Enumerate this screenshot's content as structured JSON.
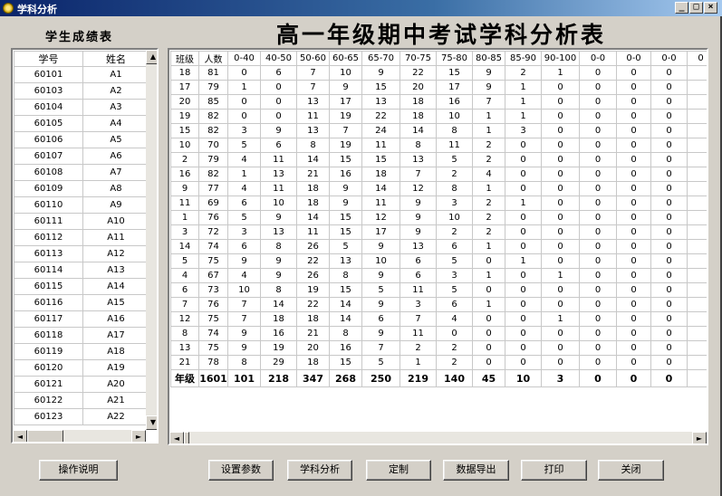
{
  "window": {
    "title": "学科分析",
    "min": "_",
    "max": "□",
    "close": "×"
  },
  "left_heading": "学生成绩表",
  "main_heading": "高一年级期中考试学科分析表",
  "students": {
    "headers": [
      "学号",
      "姓名"
    ],
    "rows": [
      [
        "60101",
        "A1"
      ],
      [
        "60103",
        "A2"
      ],
      [
        "60104",
        "A3"
      ],
      [
        "60105",
        "A4"
      ],
      [
        "60106",
        "A5"
      ],
      [
        "60107",
        "A6"
      ],
      [
        "60108",
        "A7"
      ],
      [
        "60109",
        "A8"
      ],
      [
        "60110",
        "A9"
      ],
      [
        "60111",
        "A10"
      ],
      [
        "60112",
        "A11"
      ],
      [
        "60113",
        "A12"
      ],
      [
        "60114",
        "A13"
      ],
      [
        "60115",
        "A14"
      ],
      [
        "60116",
        "A15"
      ],
      [
        "60117",
        "A16"
      ],
      [
        "60118",
        "A17"
      ],
      [
        "60119",
        "A18"
      ],
      [
        "60120",
        "A19"
      ],
      [
        "60121",
        "A20"
      ],
      [
        "60122",
        "A21"
      ],
      [
        "60123",
        "A22"
      ]
    ]
  },
  "analysis": {
    "headers": [
      "班级",
      "人数",
      "0-40",
      "40-50",
      "50-60",
      "60-65",
      "65-70",
      "70-75",
      "75-80",
      "80-85",
      "85-90",
      "90-100",
      "0-0",
      "0-0",
      "0-0",
      "0"
    ],
    "rows": [
      [
        "18",
        "81",
        "0",
        "6",
        "7",
        "10",
        "9",
        "22",
        "15",
        "9",
        "2",
        "1",
        "0",
        "0",
        "0",
        ""
      ],
      [
        "17",
        "79",
        "1",
        "0",
        "7",
        "9",
        "15",
        "20",
        "17",
        "9",
        "1",
        "0",
        "0",
        "0",
        "0",
        ""
      ],
      [
        "20",
        "85",
        "0",
        "0",
        "13",
        "17",
        "13",
        "18",
        "16",
        "7",
        "1",
        "0",
        "0",
        "0",
        "0",
        ""
      ],
      [
        "19",
        "82",
        "0",
        "0",
        "11",
        "19",
        "22",
        "18",
        "10",
        "1",
        "1",
        "0",
        "0",
        "0",
        "0",
        ""
      ],
      [
        "15",
        "82",
        "3",
        "9",
        "13",
        "7",
        "24",
        "14",
        "8",
        "1",
        "3",
        "0",
        "0",
        "0",
        "0",
        ""
      ],
      [
        "10",
        "70",
        "5",
        "6",
        "8",
        "19",
        "11",
        "8",
        "11",
        "2",
        "0",
        "0",
        "0",
        "0",
        "0",
        ""
      ],
      [
        "2",
        "79",
        "4",
        "11",
        "14",
        "15",
        "15",
        "13",
        "5",
        "2",
        "0",
        "0",
        "0",
        "0",
        "0",
        ""
      ],
      [
        "16",
        "82",
        "1",
        "13",
        "21",
        "16",
        "18",
        "7",
        "2",
        "4",
        "0",
        "0",
        "0",
        "0",
        "0",
        ""
      ],
      [
        "9",
        "77",
        "4",
        "11",
        "18",
        "9",
        "14",
        "12",
        "8",
        "1",
        "0",
        "0",
        "0",
        "0",
        "0",
        ""
      ],
      [
        "11",
        "69",
        "6",
        "10",
        "18",
        "9",
        "11",
        "9",
        "3",
        "2",
        "1",
        "0",
        "0",
        "0",
        "0",
        ""
      ],
      [
        "1",
        "76",
        "5",
        "9",
        "14",
        "15",
        "12",
        "9",
        "10",
        "2",
        "0",
        "0",
        "0",
        "0",
        "0",
        ""
      ],
      [
        "3",
        "72",
        "3",
        "13",
        "11",
        "15",
        "17",
        "9",
        "2",
        "2",
        "0",
        "0",
        "0",
        "0",
        "0",
        ""
      ],
      [
        "14",
        "74",
        "6",
        "8",
        "26",
        "5",
        "9",
        "13",
        "6",
        "1",
        "0",
        "0",
        "0",
        "0",
        "0",
        ""
      ],
      [
        "5",
        "75",
        "9",
        "9",
        "22",
        "13",
        "10",
        "6",
        "5",
        "0",
        "1",
        "0",
        "0",
        "0",
        "0",
        ""
      ],
      [
        "4",
        "67",
        "4",
        "9",
        "26",
        "8",
        "9",
        "6",
        "3",
        "1",
        "0",
        "1",
        "0",
        "0",
        "0",
        ""
      ],
      [
        "6",
        "73",
        "10",
        "8",
        "19",
        "15",
        "5",
        "11",
        "5",
        "0",
        "0",
        "0",
        "0",
        "0",
        "0",
        ""
      ],
      [
        "7",
        "76",
        "7",
        "14",
        "22",
        "14",
        "9",
        "3",
        "6",
        "1",
        "0",
        "0",
        "0",
        "0",
        "0",
        ""
      ],
      [
        "12",
        "75",
        "7",
        "18",
        "18",
        "14",
        "6",
        "7",
        "4",
        "0",
        "0",
        "1",
        "0",
        "0",
        "0",
        ""
      ],
      [
        "8",
        "74",
        "9",
        "16",
        "21",
        "8",
        "9",
        "11",
        "0",
        "0",
        "0",
        "0",
        "0",
        "0",
        "0",
        ""
      ],
      [
        "13",
        "75",
        "9",
        "19",
        "20",
        "16",
        "7",
        "2",
        "2",
        "0",
        "0",
        "0",
        "0",
        "0",
        "0",
        ""
      ],
      [
        "21",
        "78",
        "8",
        "29",
        "18",
        "15",
        "5",
        "1",
        "2",
        "0",
        "0",
        "0",
        "0",
        "0",
        "0",
        ""
      ]
    ],
    "total": [
      "年级",
      "1601",
      "101",
      "218",
      "347",
      "268",
      "250",
      "219",
      "140",
      "45",
      "10",
      "3",
      "0",
      "0",
      "0",
      ""
    ]
  },
  "buttons": {
    "help": "操作说明",
    "params": "设置参数",
    "analyze": "学科分析",
    "customize": "定制",
    "export": "数据导出",
    "print": "打印",
    "close": "关闭"
  },
  "scroll_glyphs": {
    "up": "▲",
    "down": "▼",
    "left": "◄",
    "right": "►"
  }
}
